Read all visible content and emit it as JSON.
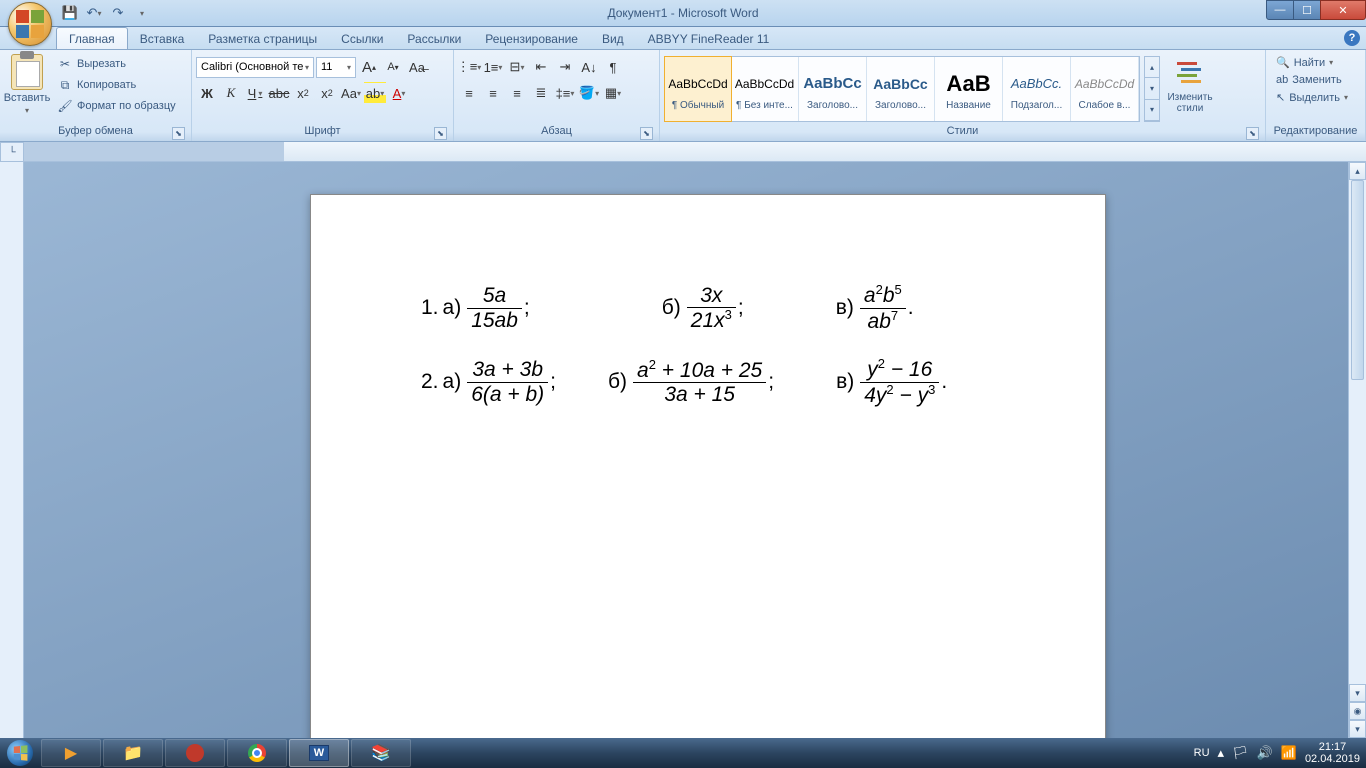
{
  "window": {
    "title": "Документ1 - Microsoft Word"
  },
  "qat": {
    "save": "💾",
    "undo": "↶",
    "redo": "↷"
  },
  "tabs": [
    {
      "label": "Главная",
      "active": true
    },
    {
      "label": "Вставка"
    },
    {
      "label": "Разметка страницы"
    },
    {
      "label": "Ссылки"
    },
    {
      "label": "Рассылки"
    },
    {
      "label": "Рецензирование"
    },
    {
      "label": "Вид"
    },
    {
      "label": "ABBYY FineReader 11"
    }
  ],
  "ribbon": {
    "clipboard": {
      "paste": "Вставить",
      "cut": "Вырезать",
      "copy": "Копировать",
      "format_painter": "Формат по образцу",
      "group": "Буфер обмена"
    },
    "font": {
      "name": "Calibri (Основной те",
      "size": "11",
      "group": "Шрифт",
      "bold": "Ж",
      "italic": "К",
      "underline": "Ч",
      "strike": "abc",
      "grow": "A",
      "shrink": "A",
      "clear": "Aa"
    },
    "paragraph": {
      "group": "Абзац"
    },
    "styles": {
      "group": "Стили",
      "change": "Изменить стили",
      "items": [
        {
          "preview": "AaBbCcDd",
          "name": "¶ Обычный",
          "sel": true,
          "color": "#000",
          "fs": "12px"
        },
        {
          "preview": "AaBbCcDd",
          "name": "¶ Без инте...",
          "color": "#000",
          "fs": "12px"
        },
        {
          "preview": "AaBbCc",
          "name": "Заголово...",
          "color": "#2a5a8a",
          "fs": "15px",
          "bold": true
        },
        {
          "preview": "AaBbCc",
          "name": "Заголово...",
          "color": "#2a5a8a",
          "fs": "14px",
          "bold": true
        },
        {
          "preview": "АаВ",
          "name": "Название",
          "color": "#000",
          "fs": "22px",
          "bold": true
        },
        {
          "preview": "AaBbCc.",
          "name": "Подзагол...",
          "color": "#2a5a8a",
          "fs": "13px",
          "ital": true
        },
        {
          "preview": "AaBbCcDd",
          "name": "Слабое в...",
          "color": "#888",
          "fs": "12px",
          "ital": true
        }
      ]
    },
    "editing": {
      "find": "Найти",
      "replace": "Заменить",
      "select": "Выделить",
      "group": "Редактирование"
    }
  },
  "document": {
    "row1": {
      "label": "1.",
      "a": {
        "lbl": "а)",
        "num": "5a",
        "den": "15ab",
        "tail": ";"
      },
      "b": {
        "lbl": "б)",
        "num": "3x",
        "den": "21x",
        "den_sup": "3",
        "tail": ";"
      },
      "v": {
        "lbl": "в)",
        "num": "a",
        "num_sup1": "2",
        "num2": "b",
        "num_sup2": "5",
        "den": "ab",
        "den_sup": "7",
        "tail": "."
      }
    },
    "row2": {
      "label": "2.",
      "a": {
        "lbl": "а)",
        "num": "3a + 3b",
        "den": "6(a + b)",
        "tail": ";"
      },
      "b": {
        "lbl": "б)",
        "num_pre": "a",
        "num_sup": "2",
        "num_post": " + 10a + 25",
        "den": "3a + 15",
        "tail": ";"
      },
      "v": {
        "lbl": "в)",
        "num_pre": "y",
        "num_sup": "2",
        "num_post": " − 16",
        "den_pre": "4y",
        "den_sup1": "2",
        "den_mid": " − y",
        "den_sup2": "3",
        "tail": "."
      }
    }
  },
  "taskbar": {
    "lang": "RU",
    "time": "21:17",
    "date": "02.04.2019"
  }
}
